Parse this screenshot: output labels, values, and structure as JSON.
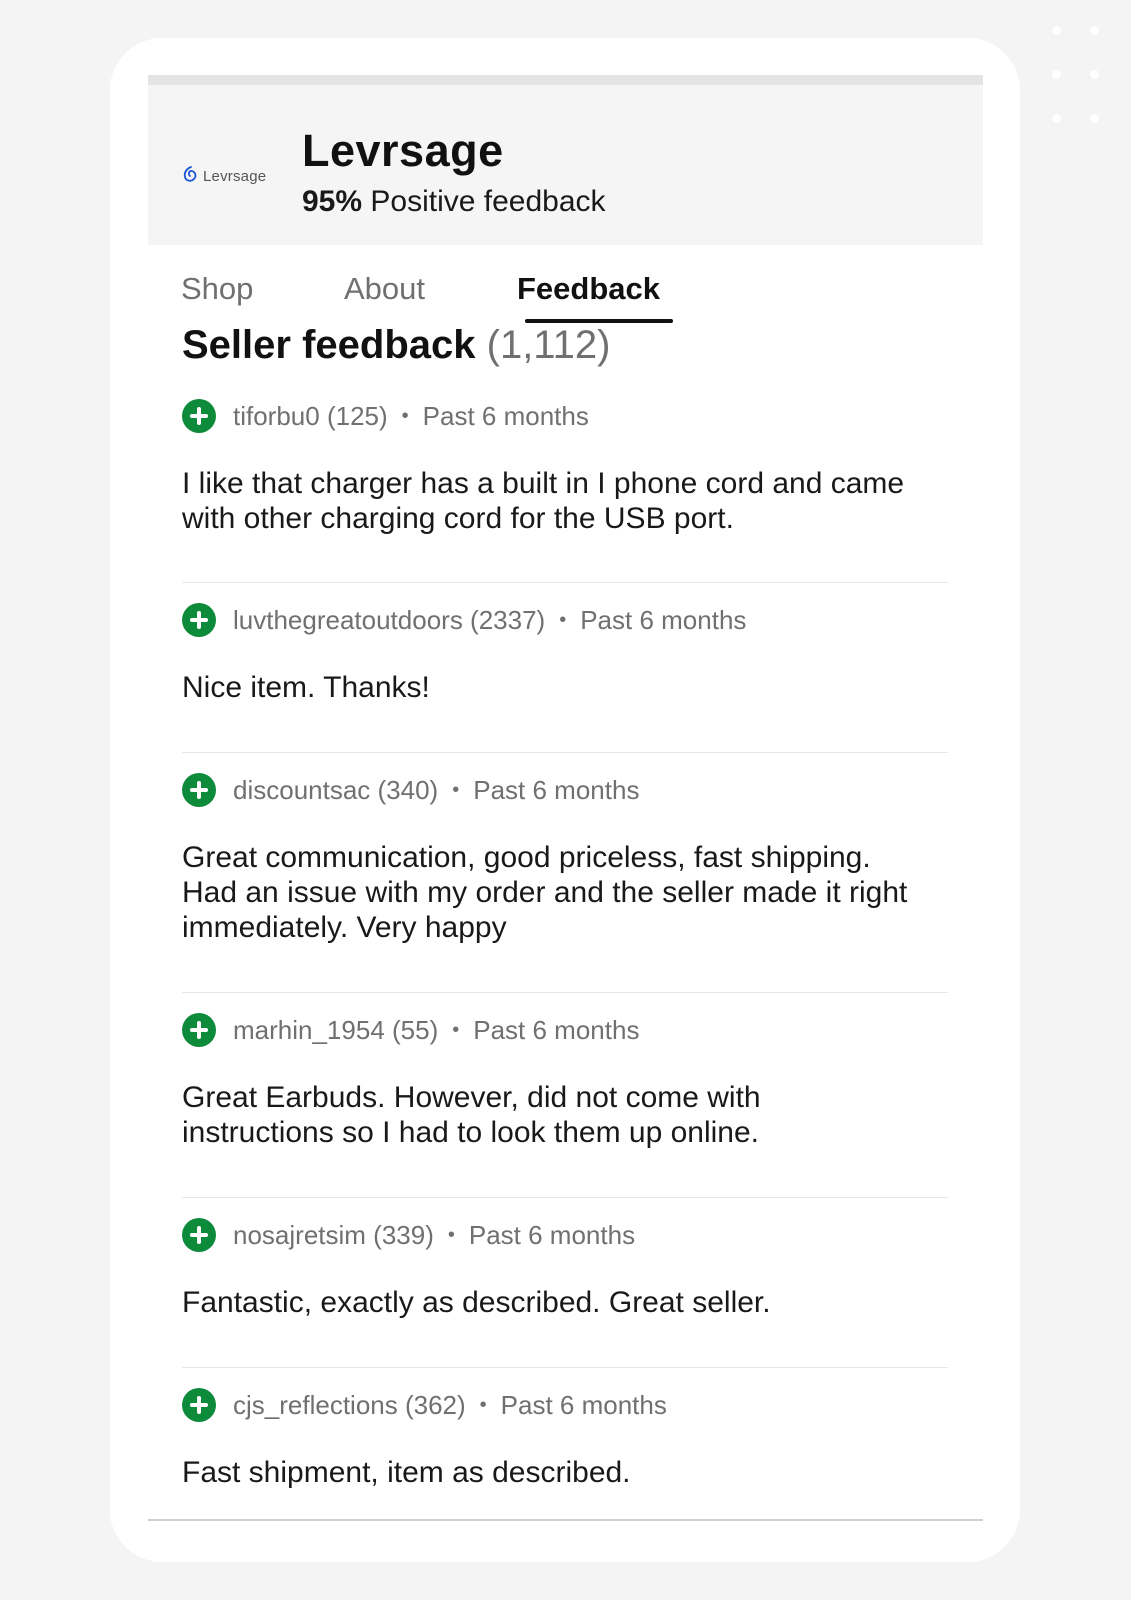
{
  "store": {
    "logo_text": "Levrsage",
    "name": "Levrsage",
    "positive_percent": "95%",
    "positive_label": "Positive feedback"
  },
  "tabs": [
    {
      "label": "Shop",
      "active": false
    },
    {
      "label": "About",
      "active": false
    },
    {
      "label": "Feedback",
      "active": true
    }
  ],
  "section": {
    "title": "Seller feedback",
    "count": "(1,112)"
  },
  "feedback": [
    {
      "user": "tiforbu0 (125)",
      "time": "Past 6 months",
      "comment": "I like that charger has a built in I phone cord and came with other charging cord for the USB port."
    },
    {
      "user": "luvthegreatoutdoors (2337)",
      "time": "Past 6 months",
      "comment": "Nice item. Thanks!"
    },
    {
      "user": "discountsac (340)",
      "time": "Past 6 months",
      "comment": "Great communication, good priceless, fast shipping. Had an issue with my order and the seller made it right immediately. Very happy"
    },
    {
      "user": "marhin_1954 (55)",
      "time": "Past 6 months",
      "comment": "Great Earbuds. However, did not come with instructions so I had to look them up online."
    },
    {
      "user": "nosajretsim (339)",
      "time": "Past 6 months",
      "comment": "Fantastic, exactly as described.  Great seller."
    },
    {
      "user": "cjs_reflections (362)",
      "time": "Past 6 months",
      "comment": "Fast shipment, item as described."
    }
  ],
  "colors": {
    "positive_green": "#0d8a3a",
    "text_primary": "#191919",
    "text_secondary": "#707070",
    "header_bg": "#f5f5f5"
  },
  "icons": {
    "positive": "plus-circle-icon",
    "logo": "swirl-logo-icon"
  }
}
